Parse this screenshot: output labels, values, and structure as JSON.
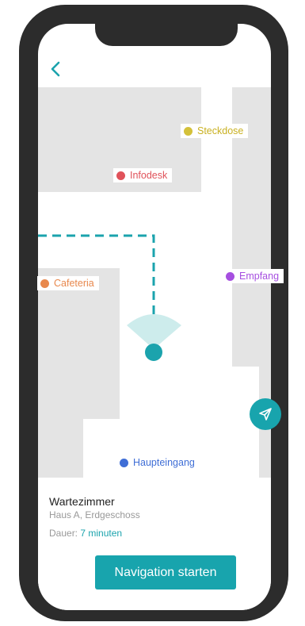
{
  "map": {
    "pois": [
      {
        "label": "Steckdose",
        "color": "#d4c13a"
      },
      {
        "label": "Infodesk",
        "color": "#e0525a"
      },
      {
        "label": "Empfang",
        "color": "#a64fe0"
      },
      {
        "label": "Cafeteria",
        "color": "#e8884d"
      },
      {
        "label": "Haupteingang",
        "color": "#3f6ed6"
      }
    ],
    "route_color": "#1ba3ad",
    "user_color": "#1ba3ad"
  },
  "destination": {
    "title": "Wartezimmer",
    "subtitle": "Haus A, Erdgeschoss",
    "duration_label": "Dauer:",
    "duration_value": "7 minuten"
  },
  "actions": {
    "start_label": "Navigation starten"
  },
  "icons": {
    "back": "chevron-left-icon",
    "send": "paper-plane-icon"
  }
}
